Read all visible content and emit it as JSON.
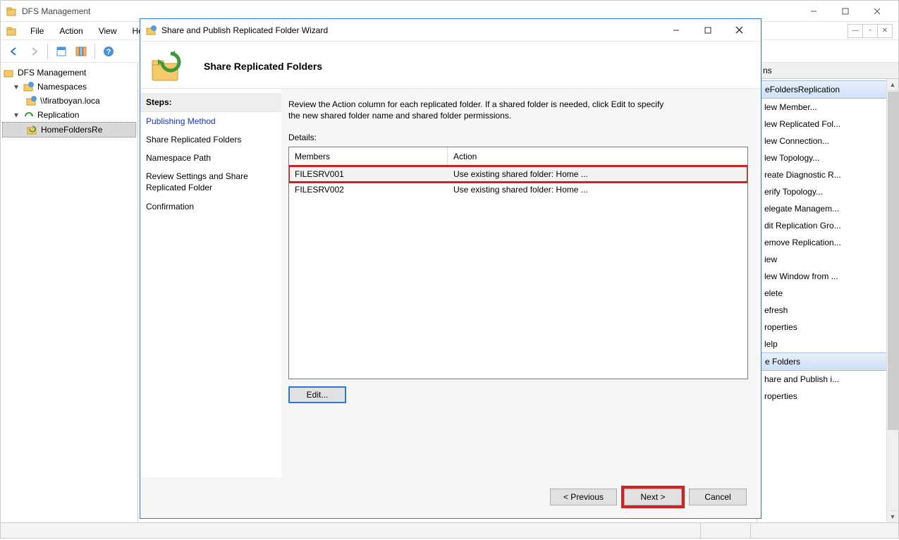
{
  "main": {
    "title": "DFS Management",
    "menus": {
      "file": "File",
      "action": "Action",
      "view": "View",
      "help": "Help"
    }
  },
  "tree": {
    "root": "DFS Management",
    "namespaces": "Namespaces",
    "ns_item": "\\\\firatboyan.loca",
    "replication": "Replication",
    "rep_item": "HomeFoldersRe"
  },
  "actions": {
    "header": "ns",
    "section1": "eFoldersReplication",
    "items1": [
      "lew Member...",
      "lew Replicated Fol...",
      "lew Connection...",
      "lew Topology...",
      "reate Diagnostic R...",
      "erify Topology...",
      "elegate Managem...",
      "dit Replication Gro...",
      "emove Replication...",
      "iew",
      "lew Window from ...",
      "elete",
      "efresh",
      "roperties",
      "lelp"
    ],
    "section2": "e Folders",
    "items2": [
      "hare and Publish i...",
      "roperties"
    ]
  },
  "wizard": {
    "title": "Share and Publish Replicated Folder Wizard",
    "heading": "Share Replicated Folders",
    "steps_label": "Steps:",
    "steps": {
      "publishing": "Publishing Method",
      "share": "Share Replicated Folders",
      "namespace": "Namespace Path",
      "review": "Review Settings and Share Replicated Folder",
      "confirmation": "Confirmation"
    },
    "instruction": "Review the Action column for each replicated folder. If a shared folder is needed, click Edit to specify the new shared folder name and shared folder permissions.",
    "details_label": "Details:",
    "columns": {
      "members": "Members",
      "action": "Action"
    },
    "rows": [
      {
        "member": "FILESRV001",
        "action": "Use existing shared folder: Home ..."
      },
      {
        "member": "FILESRV002",
        "action": "Use existing shared folder: Home ..."
      }
    ],
    "buttons": {
      "edit": "Edit...",
      "previous": "< Previous",
      "next": "Next >",
      "cancel": "Cancel"
    }
  }
}
